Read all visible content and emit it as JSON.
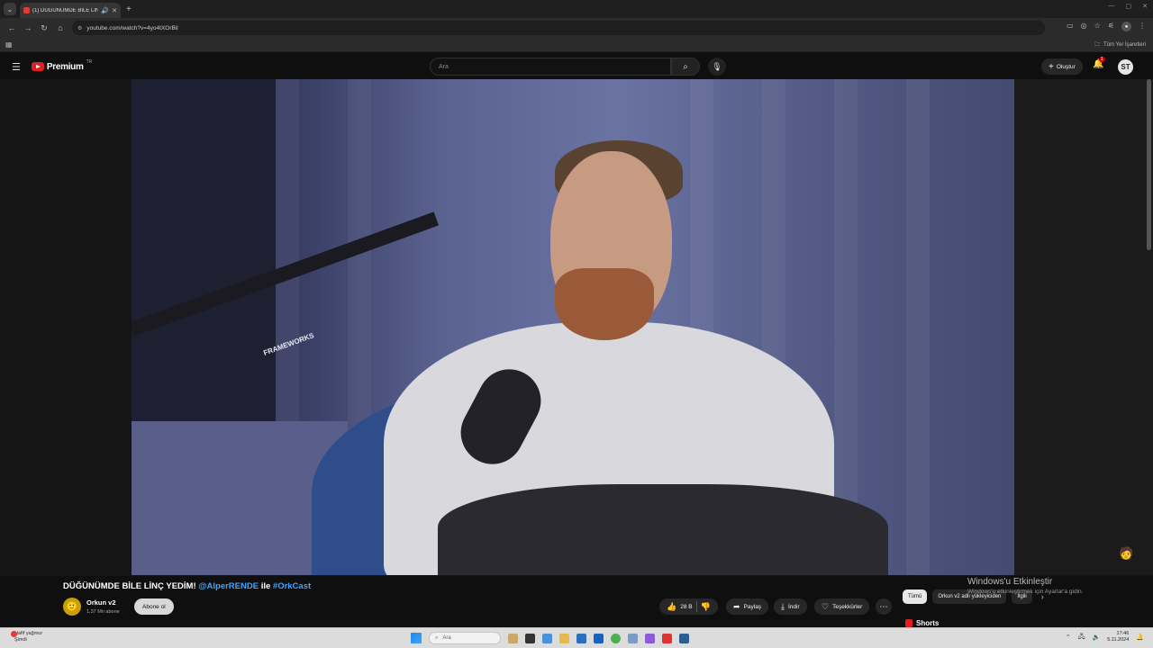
{
  "browser": {
    "tab_title": "(1) DÜĞÜNÜMDE BİLE LİNÇ",
    "url": "youtube.com/watch?v=4yo4tXOrBil",
    "bookmarks_all": "Tüm Yer İşaretleri"
  },
  "header": {
    "logo_text": "Premium",
    "logo_region": "TR",
    "search_placeholder": "Ara",
    "create_label": "Oluştur",
    "notification_count": "1",
    "profile_initials": "ST"
  },
  "video": {
    "brand_text": "FRAMEWORKS"
  },
  "info": {
    "title_main": "DÜĞÜNÜMDE BİLE LİNÇ YEDİM!",
    "title_mention": "@AlperRENDE",
    "title_ile": "ile",
    "title_hashtag": "#OrkCast",
    "channel_name": "Orkun v2",
    "subscribers": "1,37 Mn abone",
    "subscribe_label": "Abone ol",
    "likes": "28 B",
    "share_label": "Paylaş",
    "download_label": "İndir",
    "thanks_label": "Teşekkürler"
  },
  "chips": [
    "Tümü",
    "Orkun v2 adlı yükleyiciden",
    "İlgili"
  ],
  "shorts_label": "Shorts",
  "watermark": {
    "title": "Windows'u Etkinleştir",
    "subtitle": "Windows'u etkinleştirmek için Ayarlar'a gidin."
  },
  "taskbar": {
    "weather_line1": "Hafif yağmur",
    "weather_line2": "Şimdi",
    "search_placeholder": "Ara",
    "time": "17:46",
    "date": "5.11.2024"
  }
}
